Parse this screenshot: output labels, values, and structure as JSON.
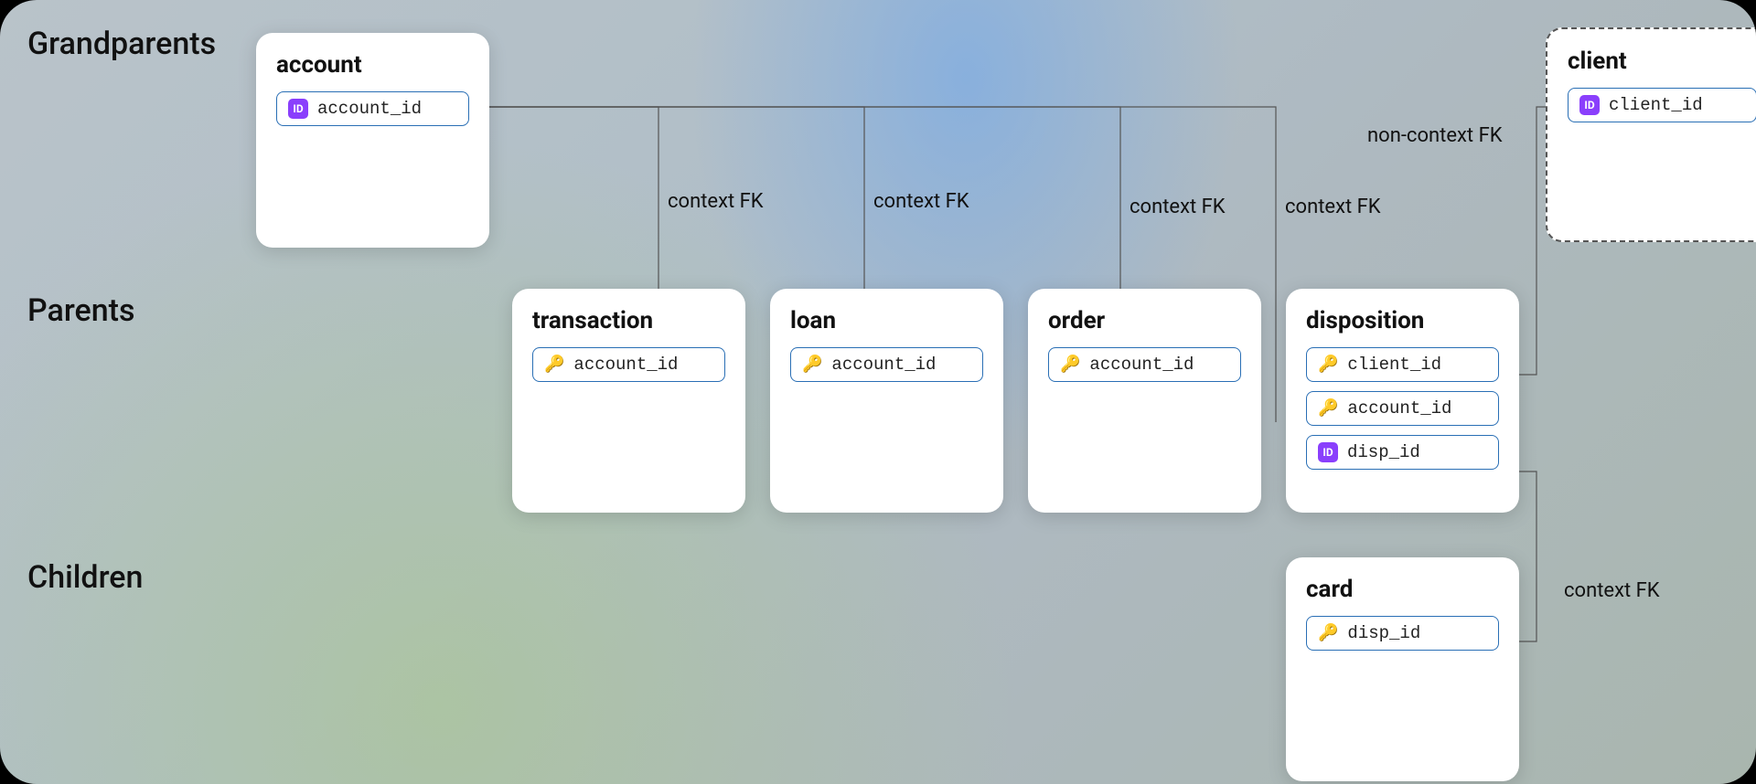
{
  "sections": {
    "grandparents": "Grandparents",
    "parents": "Parents",
    "children": "Children"
  },
  "entities": {
    "account": {
      "title": "account",
      "fields": [
        {
          "kind": "id",
          "name": "account_id"
        }
      ]
    },
    "client": {
      "title": "client",
      "fields": [
        {
          "kind": "id",
          "name": "client_id"
        }
      ]
    },
    "transaction": {
      "title": "transaction",
      "fields": [
        {
          "kind": "fk",
          "name": "account_id"
        }
      ]
    },
    "loan": {
      "title": "loan",
      "fields": [
        {
          "kind": "fk",
          "name": "account_id"
        }
      ]
    },
    "order": {
      "title": "order",
      "fields": [
        {
          "kind": "fk",
          "name": "account_id"
        }
      ]
    },
    "disposition": {
      "title": "disposition",
      "fields": [
        {
          "kind": "fk",
          "name": "client_id"
        },
        {
          "kind": "fk",
          "name": "account_id"
        },
        {
          "kind": "id",
          "name": "disp_id"
        }
      ]
    },
    "card": {
      "title": "card",
      "fields": [
        {
          "kind": "fk",
          "name": "disp_id"
        }
      ]
    }
  },
  "edge_labels": {
    "transaction_fk": "context FK",
    "loan_fk": "context FK",
    "order_fk": "context FK",
    "disposition_account_fk": "context FK",
    "disposition_client_fk": "non-context FK",
    "card_fk": "context FK"
  },
  "icons": {
    "id_badge_text": "ID",
    "key_glyph": "🔑"
  }
}
